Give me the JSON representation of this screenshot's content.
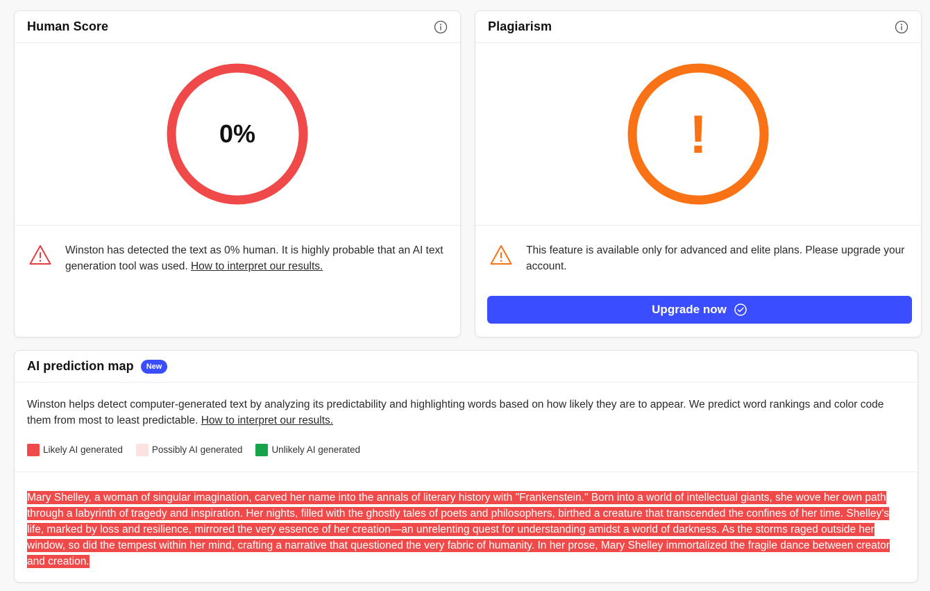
{
  "human_score": {
    "title": "Human Score",
    "value": "0%",
    "ring_color": "#f04949",
    "message": "Winston has detected the text as 0% human. It is highly probable that an AI text generation tool was used. ",
    "link": "How to interpret our results."
  },
  "plagiarism": {
    "title": "Plagiarism",
    "symbol": "!",
    "ring_color": "#f97316",
    "message": "This feature is available only for advanced and elite plans. Please upgrade your account.",
    "button_label": "Upgrade now"
  },
  "prediction_map": {
    "title": "AI prediction map",
    "badge": "New",
    "description": "Winston helps detect computer-generated text by analyzing its predictability and highlighting words based on how likely they are to appear. We predict word rankings and color code them from most to least predictable. ",
    "link": "How to interpret our results.",
    "legend": [
      {
        "label": "Likely AI generated",
        "color": "#f04949"
      },
      {
        "label": "Possibly AI generated",
        "color": "#fde2e2"
      },
      {
        "label": "Unlikely AI generated",
        "color": "#16a34a"
      }
    ],
    "analyzed_text": "Mary Shelley, a woman of singular imagination, carved her name into the annals of literary history with \"Frankenstein.\" Born into a world of intellectual giants, she wove her own path through a labyrinth of tragedy and inspiration. Her nights, filled with the ghostly tales of poets and philosophers, birthed a creature that transcended the confines of her time. Shelley's life, marked by loss and resilience, mirrored the very essence of her creation—an unrelenting quest for understanding amidst a world of darkness. As the storms raged outside her window, so did the tempest within her mind, crafting a narrative that questioned the very fabric of humanity. In her prose, Mary Shelley immortalized the fragile dance between creator and creation."
  },
  "colors": {
    "accent": "#3b4eff",
    "likely_ai": "#f04949",
    "warning": "#f97316"
  }
}
